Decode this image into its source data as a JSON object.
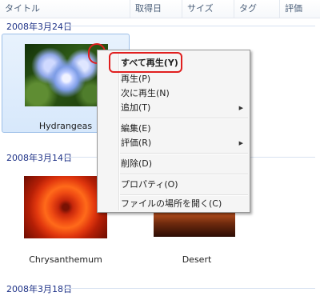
{
  "columns": [
    "タイトル",
    "取得日",
    "サイズ",
    "タグ",
    "評価"
  ],
  "groups": [
    {
      "label": "2008年3月24日"
    },
    {
      "label": "2008年3月14日"
    },
    {
      "label": "2008年3月18日"
    }
  ],
  "items": [
    {
      "title": "Hydrangeas"
    },
    {
      "title": "Chrysanthemum"
    },
    {
      "title": "Desert"
    }
  ],
  "context_menu": {
    "items": [
      {
        "label": "すべて再生(Y)"
      },
      {
        "label": "再生(P)"
      },
      {
        "label": "次に再生(N)"
      },
      {
        "label": "追加(T)"
      },
      {
        "label": "編集(E)"
      },
      {
        "label": "評価(R)"
      },
      {
        "label": "削除(D)"
      },
      {
        "label": "プロパティ(O)"
      },
      {
        "label": "ファイルの場所を開く(C)"
      }
    ]
  },
  "colors": {
    "highlight_ring": "#e01f1f",
    "selection": "#d7e8fb",
    "group_label": "#1e3287"
  }
}
